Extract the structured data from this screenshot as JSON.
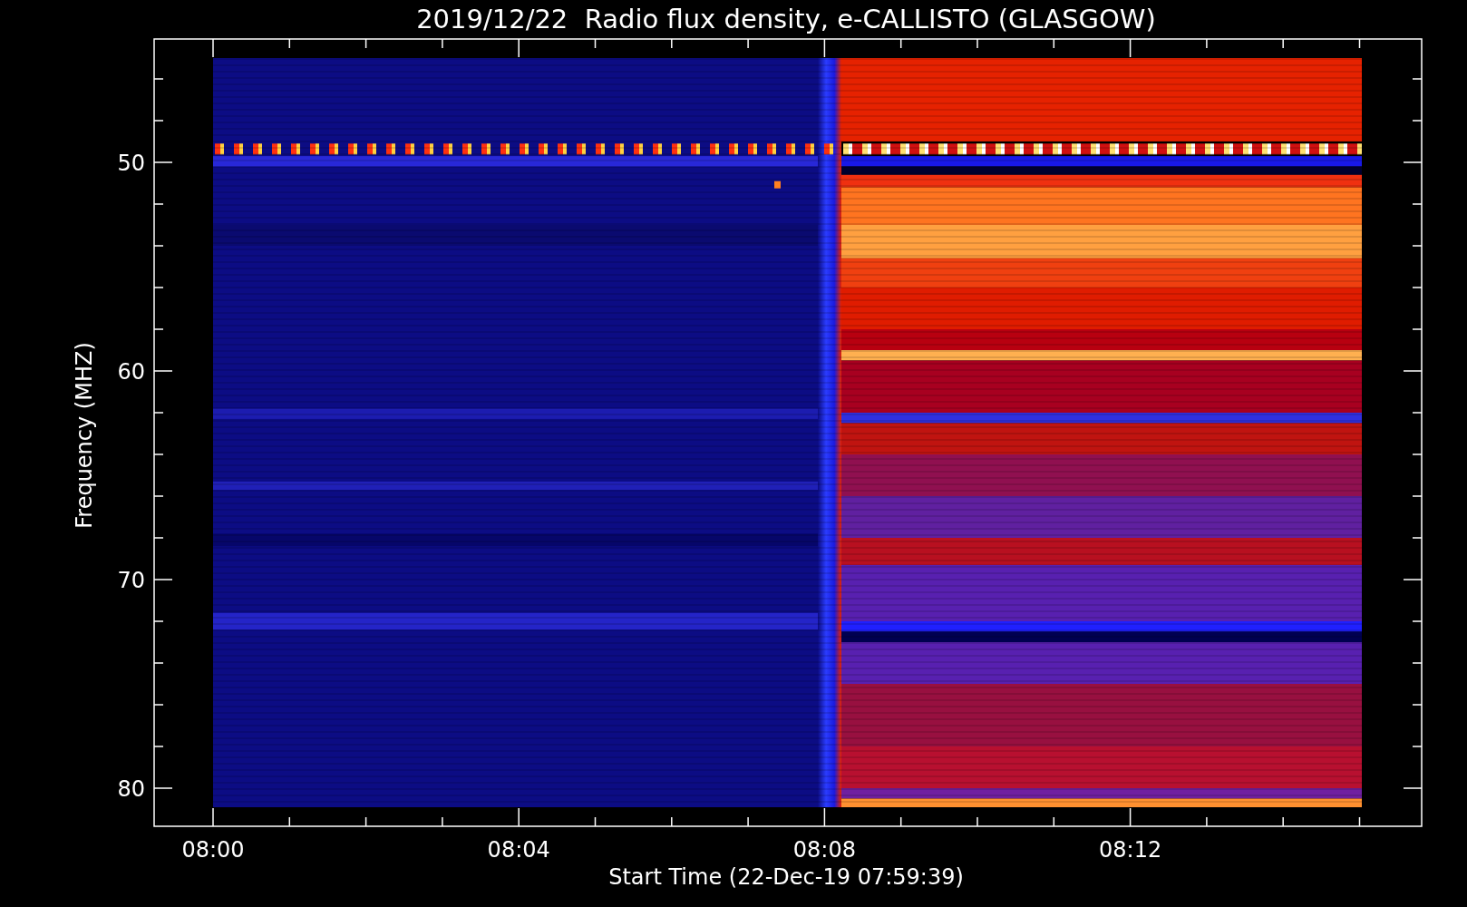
{
  "title": "2019/12/22  Radio flux density, e-CALLISTO (GLASGOW)",
  "y_axis": {
    "label": "Frequency (MHZ)",
    "ticks": [
      "50",
      "60",
      "70",
      "80"
    ]
  },
  "x_axis": {
    "label": "Start Time (22-Dec-19 07:59:39)",
    "ticks": [
      "08:00",
      "08:04",
      "08:08",
      "08:12"
    ]
  }
}
